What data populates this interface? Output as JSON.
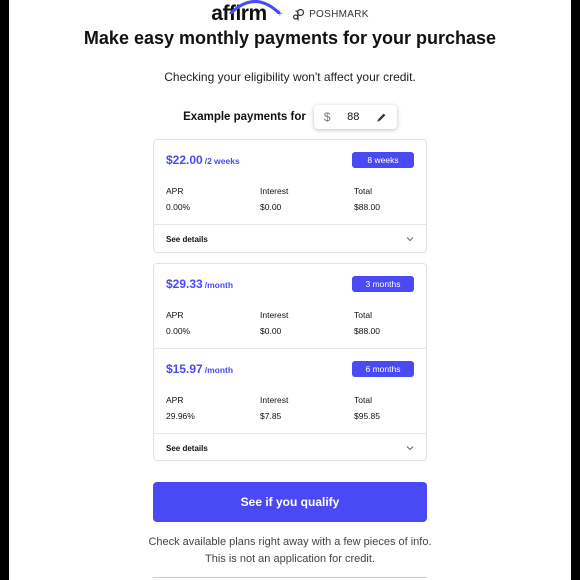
{
  "header": {
    "affirm_logo": "affirm",
    "plus": "+",
    "partner_logo": "POSHMARK"
  },
  "headline": "Make easy monthly payments for your purchase",
  "subhead": "Checking your eligibility won't affect your credit.",
  "example": {
    "label": "Example payments for",
    "currency": "$",
    "amount": "88"
  },
  "plans": [
    {
      "price": "$22.00",
      "period": "/2 weeks",
      "term": "8 weeks",
      "apr_label": "APR",
      "apr": "0.00%",
      "interest_label": "Interest",
      "interest": "$0.00",
      "total_label": "Total",
      "total": "$88.00",
      "details_label": "See details"
    },
    {
      "price": "$29.33",
      "period": "/month",
      "term": "3 months",
      "apr_label": "APR",
      "apr": "0.00%",
      "interest_label": "Interest",
      "interest": "$0.00",
      "total_label": "Total",
      "total": "$88.00"
    },
    {
      "price": "$15.97",
      "period": "/month",
      "term": "6 months",
      "apr_label": "APR",
      "apr": "29.96%",
      "interest_label": "Interest",
      "interest": "$7.85",
      "total_label": "Total",
      "total": "$95.85",
      "details_label": "See details"
    }
  ],
  "cta_label": "See if you qualify",
  "footnote": {
    "line1": "Check available plans right away with a few pieces of info.",
    "line2": "This is not an application for credit."
  },
  "colors": {
    "accent": "#4a4af4",
    "side_bars": "#000000"
  }
}
